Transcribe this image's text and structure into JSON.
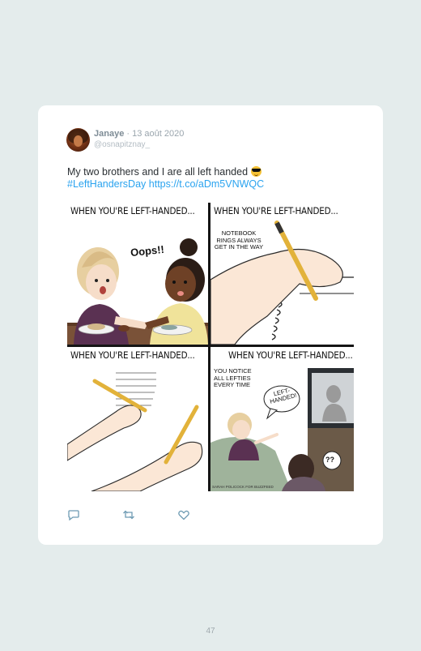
{
  "tweet": {
    "author_name": "Janaye",
    "date": "· 13 août 2020",
    "handle": "@osnapitznay_",
    "text": "My two brothers and I are all left handed",
    "emoji": "sunglasses-emoji",
    "hashtag": "#LeftHandersDay",
    "link": "https://t.co/aDm5VNWQC"
  },
  "comic": {
    "panels": [
      {
        "title": "WHEN YOU'RE LEFT-HANDED...",
        "speech": "Oops!!"
      },
      {
        "title": "WHEN YOU'RE LEFT-HANDED...",
        "caption": "NOTEBOOK RINGS ALWAYS GET IN THE WAY"
      },
      {
        "title": "WHEN YOU'RE LEFT-HANDED..."
      },
      {
        "title": "WHEN YOU'RE LEFT-HANDED...",
        "caption": "YOU NOTICE ALL LEFTIES EVERY TIME",
        "speech": "LEFT-HANDED!",
        "question": "??",
        "credit": "SARAH POLICOCK FOR BUZZFEED"
      }
    ]
  },
  "actions": {
    "icons": [
      "reply-icon",
      "retweet-icon",
      "like-icon"
    ]
  },
  "page_number": "47"
}
